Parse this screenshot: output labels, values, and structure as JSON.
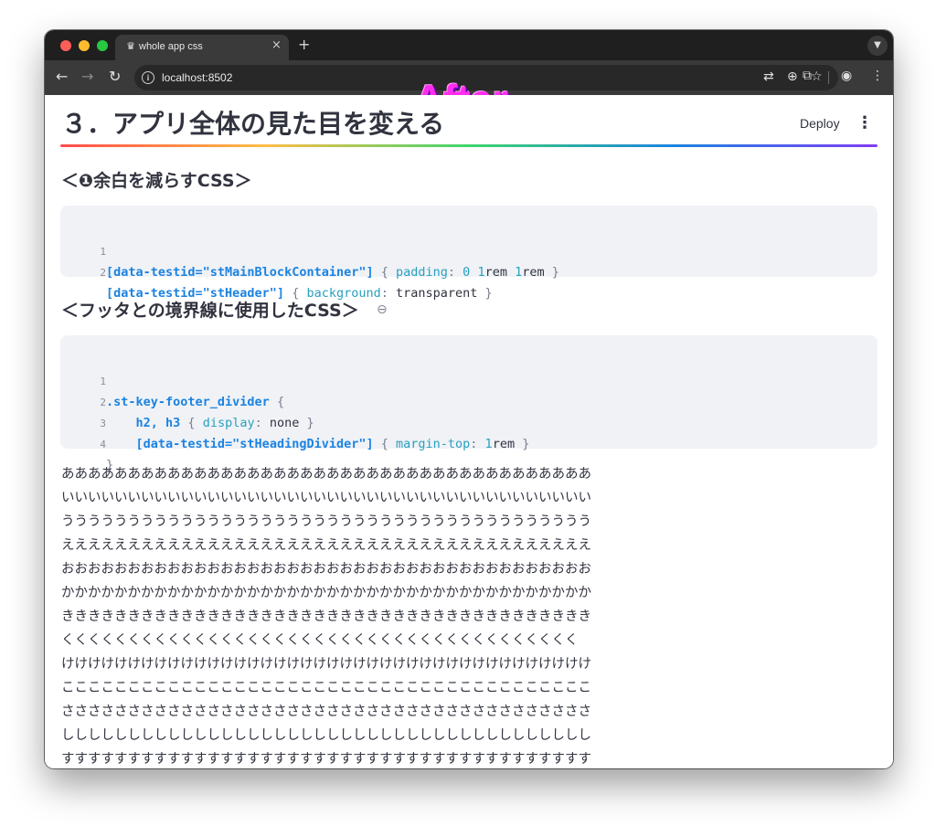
{
  "browser": {
    "tab_title": "whole app css",
    "tab_close": "×",
    "new_tab": "+",
    "tab_menu": "⌄",
    "url": "localhost:8502",
    "back": "←",
    "forward": "→",
    "reload": "↻",
    "info": "i",
    "icons": [
      "translate-icon",
      "zoom-icon",
      "star-icon",
      "extensions-icon",
      "profile-icon",
      "menu-icon"
    ],
    "traffic_lights": {
      "close": "#ff5f57",
      "minimize": "#febc2e",
      "maximize": "#28c840"
    }
  },
  "overlay": {
    "label": "After"
  },
  "app": {
    "title": "３．アプリ全体の見た目を変える",
    "deploy_label": "Deploy",
    "kebab": "⋮",
    "section1": {
      "heading": "＜❶余白を減らすCSS＞",
      "lines": [
        {
          "num": "1",
          "selector": "[data-testid=\"stMainBlockContainer\"]",
          "open": " { ",
          "prop": "padding",
          "colon": ": ",
          "v1": "0",
          "sp1": " ",
          "v2": "1",
          "v2u": "rem",
          "sp2": " ",
          "v3": "1",
          "v3u": "rem",
          "close": " }"
        },
        {
          "num": "2",
          "selector": "[data-testid=\"stHeader\"]",
          "open": " { ",
          "prop": "background",
          "colon": ": ",
          "val": "transparent",
          "close": " }"
        }
      ]
    },
    "section2": {
      "heading": "＜フッタとの境界線に使用したCSS＞",
      "link_icon": "⊖",
      "lines": [
        {
          "num": "1",
          "selector": ".st-key-footer_divider",
          "open": " {"
        },
        {
          "num": "2",
          "indent": "    ",
          "selector": "h2, h3",
          "open": " { ",
          "prop": "display",
          "colon": ": ",
          "val": "none",
          "close": " }"
        },
        {
          "num": "3",
          "indent": "    ",
          "selector": "[data-testid=\"stHeadingDivider\"]",
          "open": " { ",
          "prop": "margin-top",
          "colon": ": ",
          "v1": "1",
          "v1u": "rem",
          "close": " }"
        },
        {
          "num": "4",
          "close": "}"
        }
      ]
    },
    "body_lines": [
      "ああああああああああああああああああああああああああああああああああああああああ",
      "いいいいいいいいいいいいいいいいいいいいいいいいいいいいいいいいいいいいいいいい",
      "うううううううううううううううううううううううううううううううううううううううう",
      "ええええええええええええええええええええええええええええええええええええええええ",
      "おおおおおおおおおおおおおおおおおおおおおおおおおおおおおおおおおおおおおおおお",
      "かかかかかかかかかかかかかかかかかかかかかかかかかかかかかかかかかかかかかかかか",
      "きききききききききききききききききききききききききききききききききききききききき",
      "くくくくくくくくくくくくくくくくくくくくくくくくくくくくくくくくくくくくくくく",
      "けけけけけけけけけけけけけけけけけけけけけけけけけけけけけけけけけけけけけけけけ",
      "ここここここここここここここここここここここここここここここここここここここここ",
      "ささささささささささささささささささささささささささささささささささささささささ",
      "しししししししししししししししししししししししししししししししししししししししし",
      "すすすすすすすすすすすすすすすすすすすすすすすすすすすすすすすすすすすすすすすす"
    ]
  }
}
